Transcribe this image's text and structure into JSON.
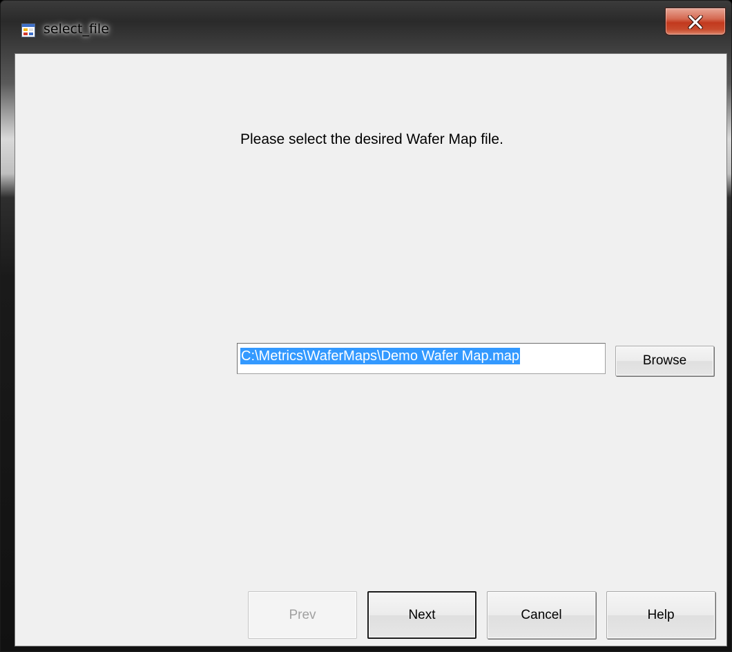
{
  "window": {
    "title": "select_file",
    "close_symbol": "x"
  },
  "prompt": "Please select the desired Wafer Map file.",
  "file_path": {
    "value": "C:\\Metrics\\WaferMaps\\Demo Wafer Map.map"
  },
  "buttons": {
    "browse": "Browse",
    "prev": "Prev",
    "next": "Next",
    "cancel": "Cancel",
    "help": "Help"
  },
  "icons": {
    "app": "form-app-icon",
    "close": "close-icon"
  },
  "colors": {
    "selection": "#3399ff",
    "close_button": "#c2391e",
    "client_background": "#f0f0f0"
  }
}
